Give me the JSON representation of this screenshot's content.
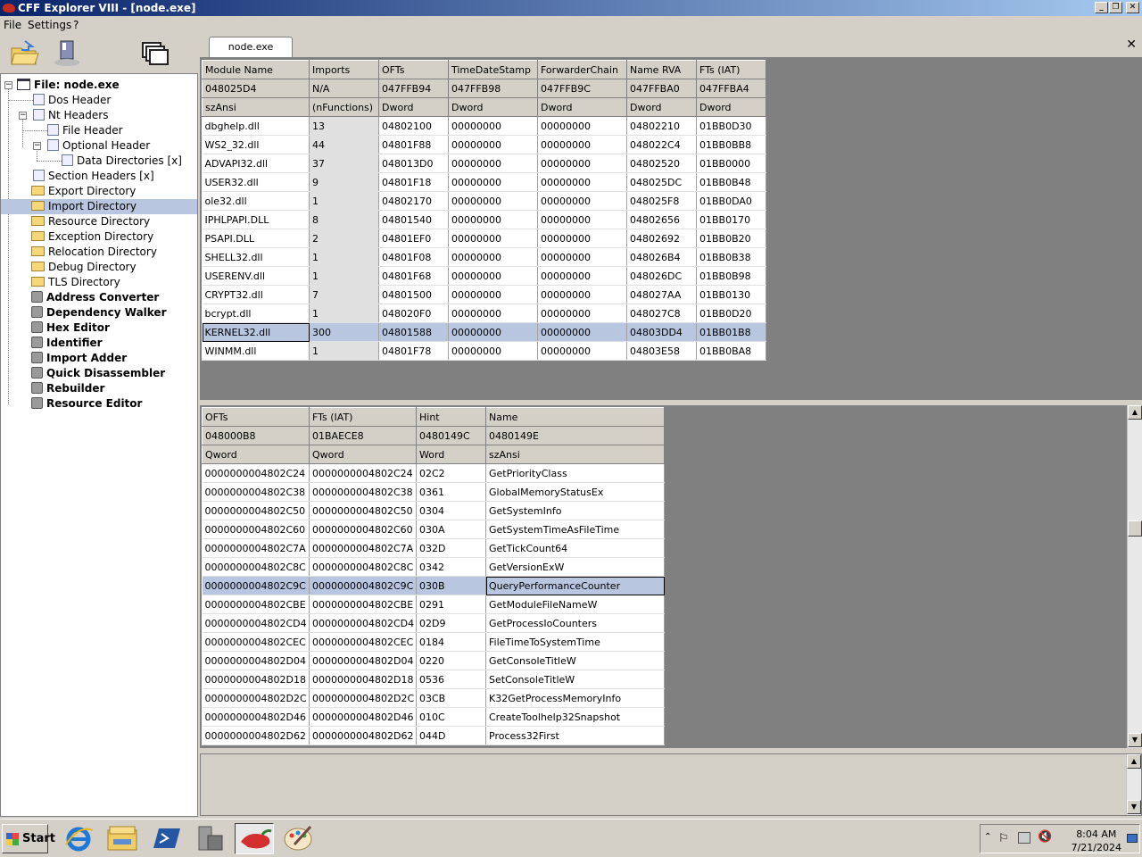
{
  "window": {
    "title": "CFF Explorer VIII - [node.exe]"
  },
  "menu": {
    "items": [
      "File",
      "Settings",
      "?"
    ]
  },
  "tab": {
    "label": "node.exe",
    "close": "✕"
  },
  "tree": {
    "root": "File: node.exe",
    "items": [
      "Dos Header",
      "Nt Headers",
      "File Header",
      "Optional Header",
      "Data Directories [x]",
      "Section Headers [x]",
      "Export Directory",
      "Import Directory",
      "Resource Directory",
      "Exception Directory",
      "Relocation Directory",
      "Debug Directory",
      "TLS Directory",
      "Address Converter",
      "Dependency Walker",
      "Hex Editor",
      "Identifier",
      "Import Adder",
      "Quick Disassembler",
      "Rebuilder",
      "Resource Editor"
    ]
  },
  "imports_table": {
    "headers": [
      "Module Name",
      "Imports",
      "OFTs",
      "TimeDateStamp",
      "ForwarderChain",
      "Name RVA",
      "FTs (IAT)"
    ],
    "offsets": [
      "048025D4",
      "N/A",
      "047FFB94",
      "047FFB98",
      "047FFB9C",
      "047FFBA0",
      "047FFBA4"
    ],
    "types": [
      "szAnsi",
      "(nFunctions)",
      "Dword",
      "Dword",
      "Dword",
      "Dword",
      "Dword"
    ],
    "rows": [
      [
        "dbghelp.dll",
        "13",
        "04802100",
        "00000000",
        "00000000",
        "04802210",
        "01BB0D30"
      ],
      [
        "WS2_32.dll",
        "44",
        "04801F88",
        "00000000",
        "00000000",
        "048022C4",
        "01BB0BB8"
      ],
      [
        "ADVAPI32.dll",
        "37",
        "048013D0",
        "00000000",
        "00000000",
        "04802520",
        "01BB0000"
      ],
      [
        "USER32.dll",
        "9",
        "04801F18",
        "00000000",
        "00000000",
        "048025DC",
        "01BB0B48"
      ],
      [
        "ole32.dll",
        "1",
        "04802170",
        "00000000",
        "00000000",
        "048025F8",
        "01BB0DA0"
      ],
      [
        "IPHLPAPI.DLL",
        "8",
        "04801540",
        "00000000",
        "00000000",
        "04802656",
        "01BB0170"
      ],
      [
        "PSAPI.DLL",
        "2",
        "04801EF0",
        "00000000",
        "00000000",
        "04802692",
        "01BB0B20"
      ],
      [
        "SHELL32.dll",
        "1",
        "04801F08",
        "00000000",
        "00000000",
        "048026B4",
        "01BB0B38"
      ],
      [
        "USERENV.dll",
        "1",
        "04801F68",
        "00000000",
        "00000000",
        "048026DC",
        "01BB0B98"
      ],
      [
        "CRYPT32.dll",
        "7",
        "04801500",
        "00000000",
        "00000000",
        "048027AA",
        "01BB0130"
      ],
      [
        "bcrypt.dll",
        "1",
        "048020F0",
        "00000000",
        "00000000",
        "048027C8",
        "01BB0D20"
      ],
      [
        "KERNEL32.dll",
        "300",
        "04801588",
        "00000000",
        "00000000",
        "04803DD4",
        "01BB01B8"
      ],
      [
        "WINMM.dll",
        "1",
        "04801F78",
        "00000000",
        "00000000",
        "04803E58",
        "01BB0BA8"
      ]
    ],
    "selected_row": 11
  },
  "functions_table": {
    "headers": [
      "OFTs",
      "FTs (IAT)",
      "Hint",
      "Name"
    ],
    "offsets": [
      "048000B8",
      "01BAECE8",
      "0480149C",
      "0480149E"
    ],
    "types": [
      "Qword",
      "Qword",
      "Word",
      "szAnsi"
    ],
    "rows": [
      [
        "0000000004802C24",
        "0000000004802C24",
        "02C2",
        "GetPriorityClass"
      ],
      [
        "0000000004802C38",
        "0000000004802C38",
        "0361",
        "GlobalMemoryStatusEx"
      ],
      [
        "0000000004802C50",
        "0000000004802C50",
        "0304",
        "GetSystemInfo"
      ],
      [
        "0000000004802C60",
        "0000000004802C60",
        "030A",
        "GetSystemTimeAsFileTime"
      ],
      [
        "0000000004802C7A",
        "0000000004802C7A",
        "032D",
        "GetTickCount64"
      ],
      [
        "0000000004802C8C",
        "0000000004802C8C",
        "0342",
        "GetVersionExW"
      ],
      [
        "0000000004802C9C",
        "0000000004802C9C",
        "030B",
        "QueryPerformanceCounter"
      ],
      [
        "0000000004802CBE",
        "0000000004802CBE",
        "0291",
        "GetModuleFileNameW"
      ],
      [
        "0000000004802CD4",
        "0000000004802CD4",
        "02D9",
        "GetProcessIoCounters"
      ],
      [
        "0000000004802CEC",
        "0000000004802CEC",
        "0184",
        "FileTimeToSystemTime"
      ],
      [
        "0000000004802D04",
        "0000000004802D04",
        "0220",
        "GetConsoleTitleW"
      ],
      [
        "0000000004802D18",
        "0000000004802D18",
        "0536",
        "SetConsoleTitleW"
      ],
      [
        "0000000004802D2C",
        "0000000004802D2C",
        "03CB",
        "K32GetProcessMemoryInfo"
      ],
      [
        "0000000004802D46",
        "0000000004802D46",
        "010C",
        "CreateToolhelp32Snapshot"
      ],
      [
        "0000000004802D62",
        "0000000004802D62",
        "044D",
        "Process32First"
      ]
    ],
    "selected_row": 6
  },
  "taskbar": {
    "start_label": "Start",
    "apps": [
      "ie-icon",
      "explorer-icon",
      "powershell-icon",
      "server-manager-icon",
      "cff-explorer-icon",
      "paint-icon"
    ],
    "time": "8:04 AM",
    "date": "7/21/2024"
  }
}
